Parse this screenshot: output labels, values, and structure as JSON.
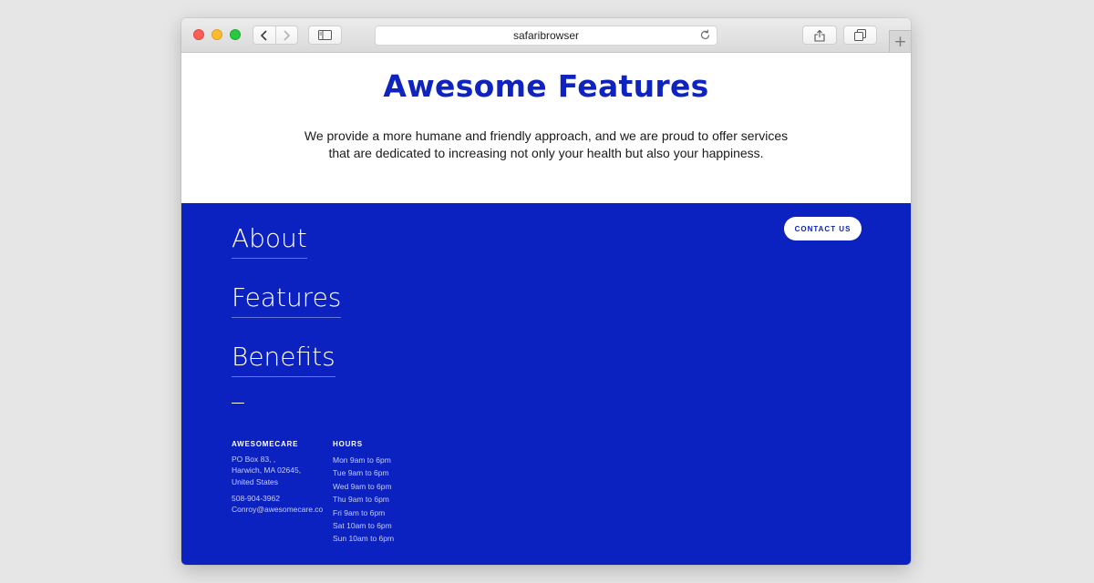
{
  "browser": {
    "address": "safaribrowser",
    "colors": {
      "close": "#fc5f57",
      "minimize": "#fdbc2e",
      "zoom": "#28c840"
    },
    "icons": [
      "back-icon",
      "forward-icon",
      "sidebar-icon",
      "reload-icon",
      "share-icon",
      "tabs-icon",
      "plus-icon"
    ]
  },
  "hero": {
    "title": "Awesome Features",
    "desc_line1": "We provide a more humane and friendly approach, and we are proud to offer services",
    "desc_line2": "that are dedicated to increasing not only your health but also your happiness."
  },
  "footer": {
    "nav": {
      "about": "About",
      "features": "Features",
      "benefits": "Benefits"
    },
    "dash": "—",
    "contact_label": "CONTACT US",
    "company": {
      "name": "AWESOMECARE",
      "address_line1": "PO Box 83, ,",
      "address_line2": "Harwich, MA 02645,",
      "address_line3": "United States",
      "phone": "508-904-3962",
      "email": "Conroy@awesomecare.co"
    },
    "hours": {
      "heading": "HOURS",
      "rows": [
        "Mon 9am to 6pm",
        "Tue 9am to 6pm",
        "Wed 9am to 6pm",
        "Thu 9am to 6pm",
        "Fri 9am to 6pm",
        "Sat 10am to 6pm",
        "Sun 10am to 6pm"
      ]
    }
  },
  "colors": {
    "brand_blue": "#0c22c0",
    "title_blue": "#0f23be",
    "background": "#e6e6e6"
  }
}
